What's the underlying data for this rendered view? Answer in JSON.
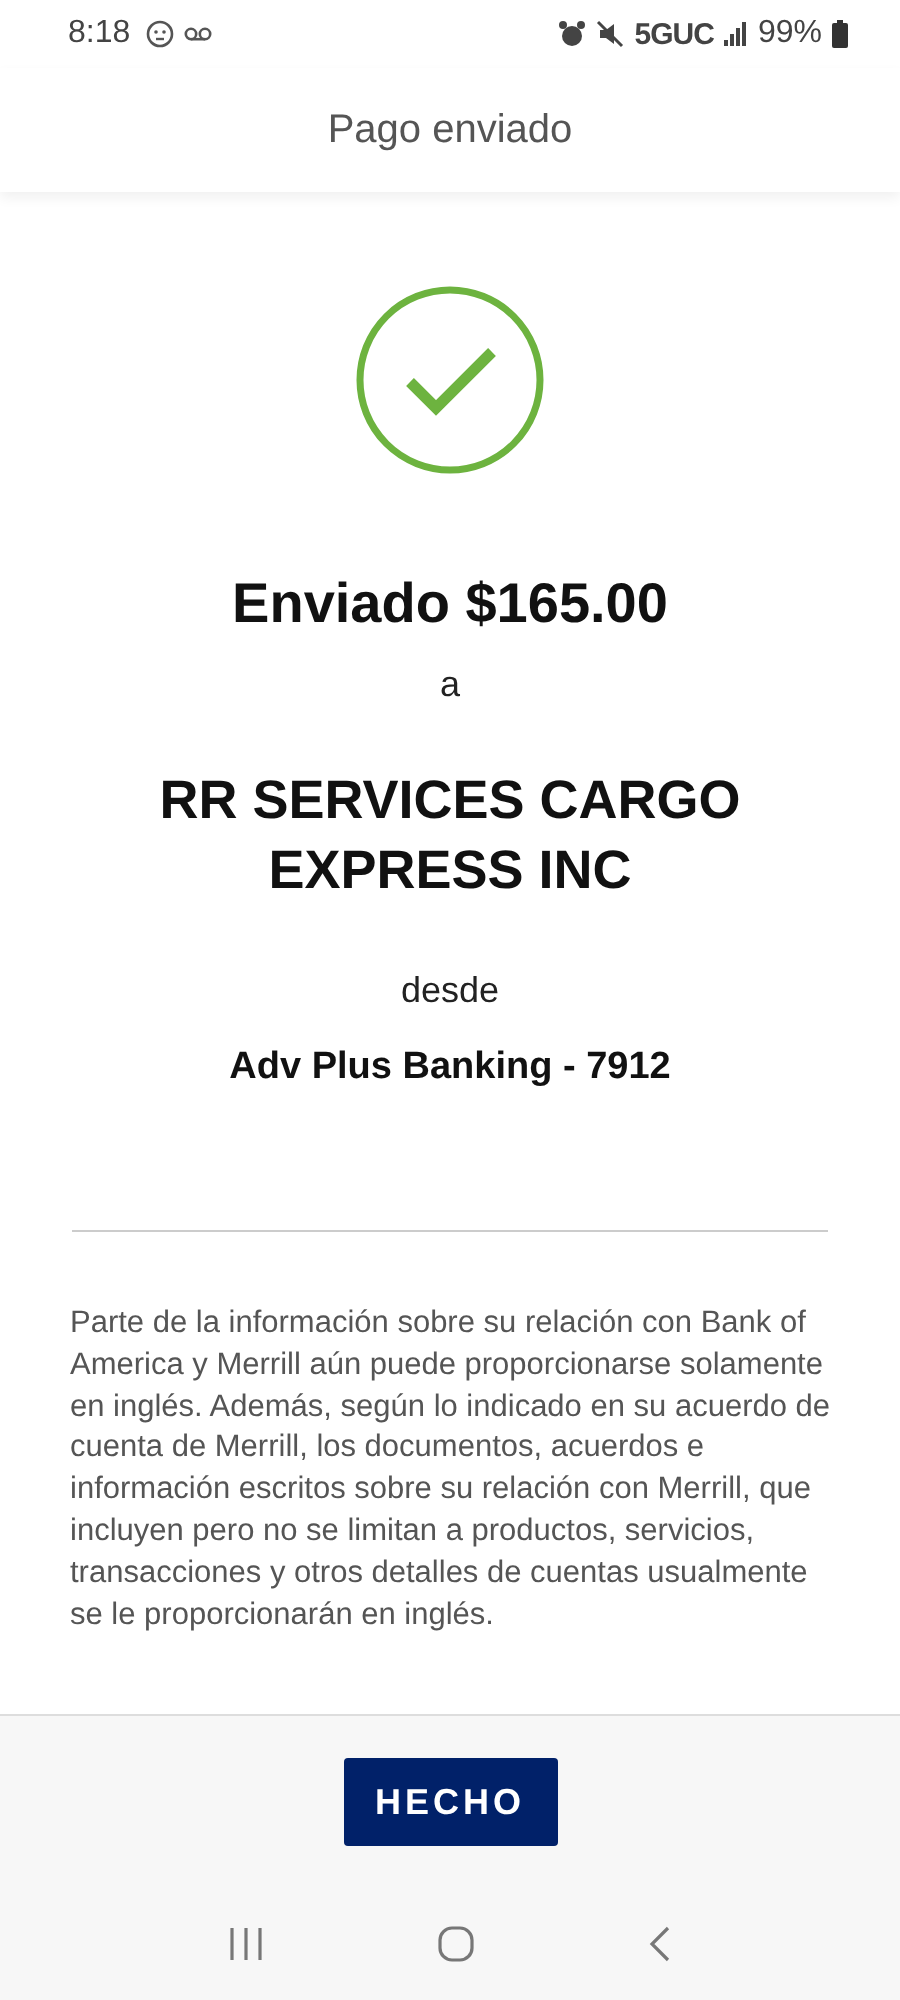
{
  "status_bar": {
    "time": "8:18",
    "network": "5GUC",
    "battery": "99%"
  },
  "header": {
    "title": "Pago enviado"
  },
  "confirmation": {
    "amount_line": "Enviado $165.00",
    "to_word": "a",
    "recipient": "RR SERVICES CARGO EXPRESS INC",
    "from_word": "desde",
    "account": "Adv Plus Banking - 7912"
  },
  "disclaimer": "Parte de la información sobre su relación con Bank of America y Merrill aún puede proporcionarse solamente en inglés. Además, según lo indicado en su acuerdo de cuenta de Merrill, los documentos, acuerdos e información escritos sobre su relación con Merrill, que incluyen pero no se limitan a productos, servicios, transacciones y otros detalles de cuentas usualmente se le proporcionarán en inglés.",
  "done_button": "HECHO"
}
